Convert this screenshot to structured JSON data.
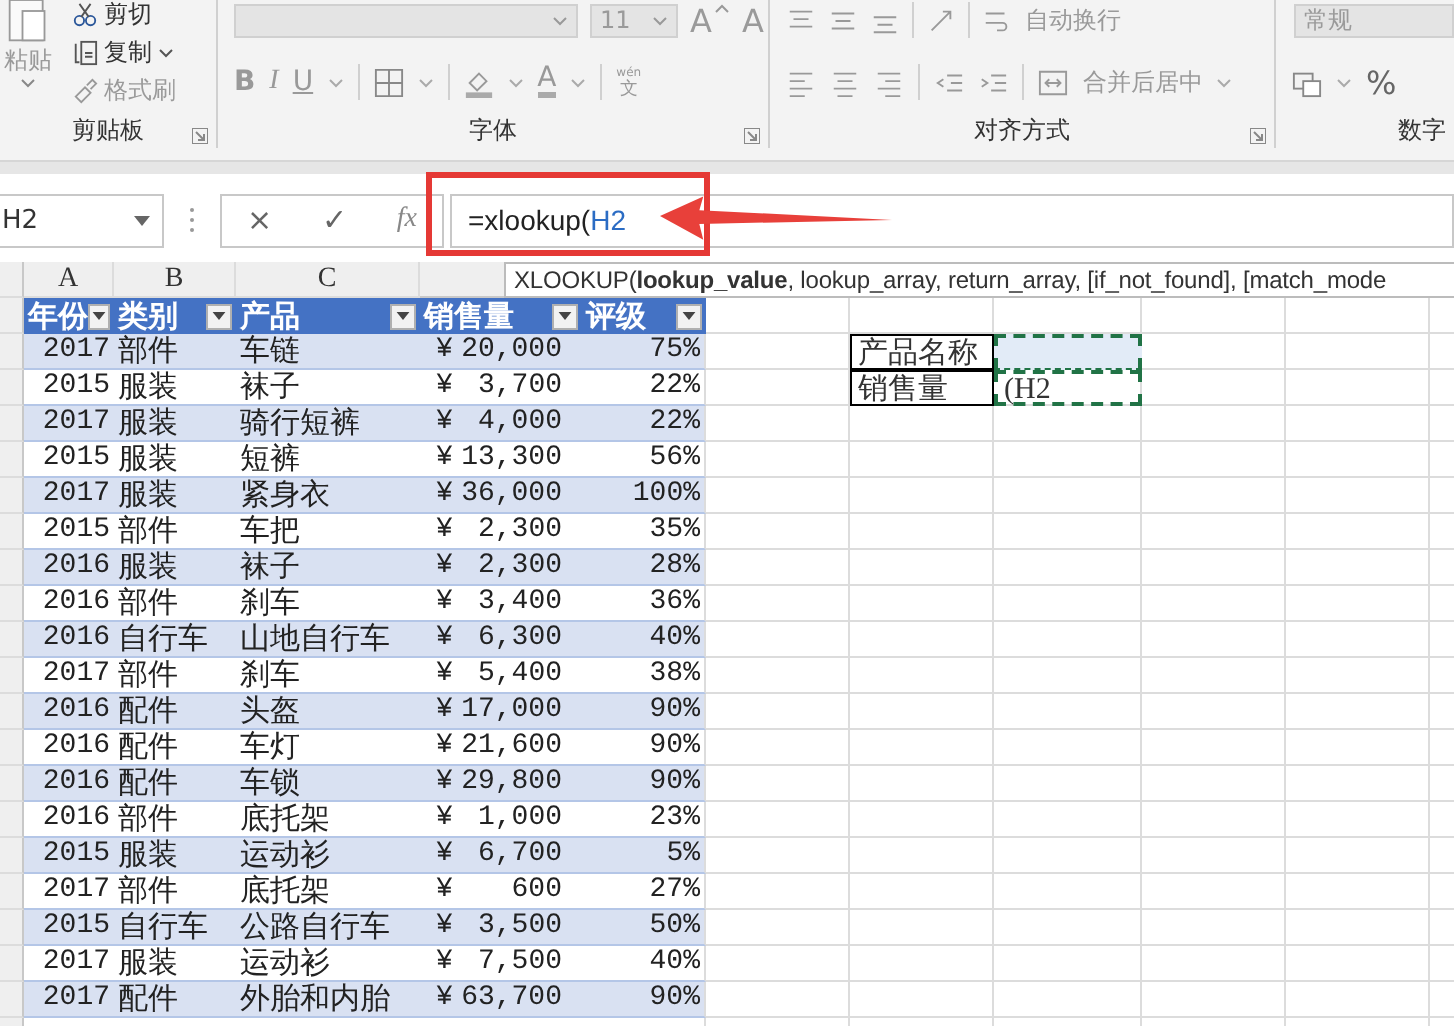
{
  "ribbon": {
    "clipboard": {
      "paste": "粘贴",
      "cut": "剪切",
      "copy": "复制",
      "format_painter": "格式刷",
      "label": "剪贴板"
    },
    "font": {
      "size": "11",
      "grow": "A",
      "shrink": "A",
      "bold": "B",
      "italic": "I",
      "underline": "U",
      "font_color": "A",
      "phonetic_top": "wén",
      "phonetic": "文",
      "label": "字体"
    },
    "alignment": {
      "wrap": "自动换行",
      "merge": "合并后居中",
      "label": "对齐方式"
    },
    "number": {
      "format": "常规",
      "percent": "%",
      "label": "数字"
    }
  },
  "formula_bar": {
    "name_box": "H2",
    "cancel": "×",
    "enter": "✓",
    "fx": "fx",
    "formula": "=xlookup(",
    "formula_reference": "H2"
  },
  "tooltip": "XLOOKUP(**lookup_value**, lookup_array, return_array, [if_not_found], [match_mode",
  "columns": [
    "A",
    "B",
    "C"
  ],
  "table": {
    "headers": [
      "年份",
      "类别",
      "产品",
      "销售量",
      "评级"
    ],
    "rows": [
      {
        "year": "2017",
        "category": "部件",
        "product": "车链",
        "currency": "¥",
        "sales": "20,000",
        "rating": "75%"
      },
      {
        "year": "2015",
        "category": "服装",
        "product": "袜子",
        "currency": "¥",
        "sales": "3,700",
        "rating": "22%"
      },
      {
        "year": "2017",
        "category": "服装",
        "product": "骑行短裤",
        "currency": "¥",
        "sales": "4,000",
        "rating": "22%"
      },
      {
        "year": "2015",
        "category": "服装",
        "product": "短裤",
        "currency": "¥",
        "sales": "13,300",
        "rating": "56%"
      },
      {
        "year": "2017",
        "category": "服装",
        "product": "紧身衣",
        "currency": "¥",
        "sales": "36,000",
        "rating": "100%"
      },
      {
        "year": "2015",
        "category": "部件",
        "product": "车把",
        "currency": "¥",
        "sales": "2,300",
        "rating": "35%"
      },
      {
        "year": "2016",
        "category": "服装",
        "product": "袜子",
        "currency": "¥",
        "sales": "2,300",
        "rating": "28%"
      },
      {
        "year": "2016",
        "category": "部件",
        "product": "刹车",
        "currency": "¥",
        "sales": "3,400",
        "rating": "36%"
      },
      {
        "year": "2016",
        "category": "自行车",
        "product": "山地自行车",
        "currency": "¥",
        "sales": "6,300",
        "rating": "40%"
      },
      {
        "year": "2017",
        "category": "部件",
        "product": "刹车",
        "currency": "¥",
        "sales": "5,400",
        "rating": "38%"
      },
      {
        "year": "2016",
        "category": "配件",
        "product": "头盔",
        "currency": "¥",
        "sales": "17,000",
        "rating": "90%"
      },
      {
        "year": "2016",
        "category": "配件",
        "product": "车灯",
        "currency": "¥",
        "sales": "21,600",
        "rating": "90%"
      },
      {
        "year": "2016",
        "category": "配件",
        "product": "车锁",
        "currency": "¥",
        "sales": "29,800",
        "rating": "90%"
      },
      {
        "year": "2016",
        "category": "部件",
        "product": "底托架",
        "currency": "¥",
        "sales": "1,000",
        "rating": "23%"
      },
      {
        "year": "2015",
        "category": "服装",
        "product": "运动衫",
        "currency": "¥",
        "sales": "6,700",
        "rating": "5%"
      },
      {
        "year": "2017",
        "category": "部件",
        "product": "底托架",
        "currency": "¥",
        "sales": "600",
        "rating": "27%"
      },
      {
        "year": "2015",
        "category": "自行车",
        "product": "公路自行车",
        "currency": "¥",
        "sales": "3,500",
        "rating": "50%"
      },
      {
        "year": "2017",
        "category": "服装",
        "product": "运动衫",
        "currency": "¥",
        "sales": "7,500",
        "rating": "40%"
      },
      {
        "year": "2017",
        "category": "配件",
        "product": "外胎和内胎",
        "currency": "¥",
        "sales": "63,700",
        "rating": "90%"
      }
    ]
  },
  "lookup": [
    {
      "label": "产品名称",
      "selected": true
    },
    {
      "label": "销售量",
      "value": "(H2",
      "selected": false
    }
  ]
}
